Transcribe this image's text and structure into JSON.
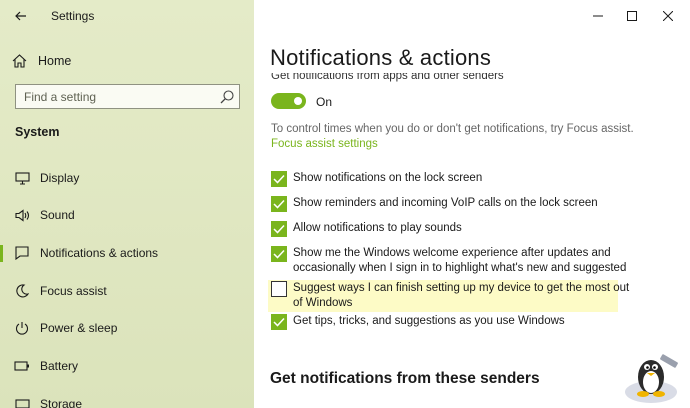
{
  "window": {
    "title": "Settings"
  },
  "sidebar": {
    "home_label": "Home",
    "search_placeholder": "Find a setting",
    "section": "System",
    "items": [
      {
        "label": "Display",
        "icon": "display-icon"
      },
      {
        "label": "Sound",
        "icon": "speaker-icon"
      },
      {
        "label": "Notifications & actions",
        "icon": "notification-icon",
        "active": true
      },
      {
        "label": "Focus assist",
        "icon": "moon-icon"
      },
      {
        "label": "Power & sleep",
        "icon": "power-icon"
      },
      {
        "label": "Battery",
        "icon": "battery-icon"
      },
      {
        "label": "Storage",
        "icon": "storage-icon"
      }
    ]
  },
  "main": {
    "title": "Notifications & actions",
    "get_notifications_label": "Get notifications from apps and other senders",
    "toggle_state": "On",
    "help_text": "To control times when you do or don't get notifications, try Focus assist.",
    "focus_link": "Focus assist settings",
    "checkboxes": [
      {
        "label": "Show notifications on the lock screen",
        "checked": true
      },
      {
        "label": "Show reminders and incoming VoIP calls on the lock screen",
        "checked": true
      },
      {
        "label": "Allow notifications to play sounds",
        "checked": true
      },
      {
        "label_line1": "Show me the Windows welcome experience after updates and",
        "label_line2": "occasionally when I sign in to highlight what's new and suggested",
        "checked": true
      },
      {
        "label_line1": "Suggest ways I can finish setting up my device to get the most out",
        "label_line2": "of Windows",
        "checked": false
      },
      {
        "label": "Get tips, tricks, and suggestions as you use Windows",
        "checked": true
      }
    ],
    "senders_heading": "Get notifications from these senders"
  },
  "colors": {
    "accent": "#7ab51d",
    "sidebar_bg": "#e1e8c3",
    "highlight": "#fdfbc6"
  }
}
